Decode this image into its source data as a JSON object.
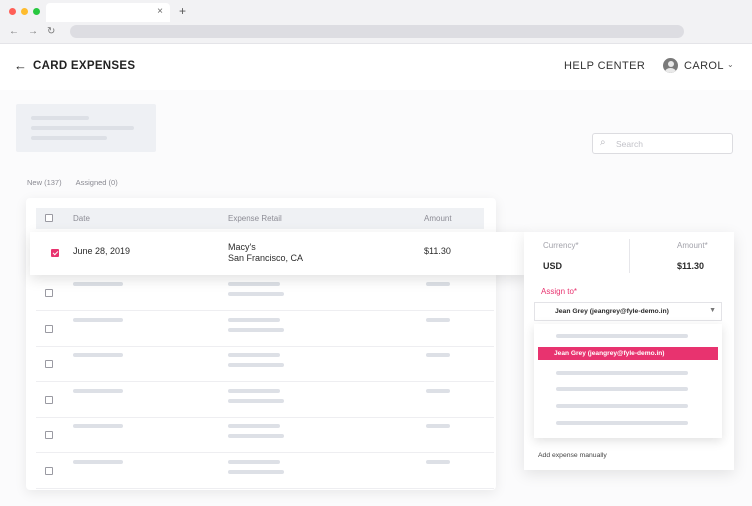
{
  "browser": {
    "dot_colors": [
      "#ff5f57",
      "#febc2e",
      "#28c840"
    ],
    "tab_close": "×",
    "new_tab": "+",
    "nav_back": "←",
    "nav_forward": "→",
    "nav_reload": "↻"
  },
  "header": {
    "back_icon": "←",
    "title": "CARD EXPENSES",
    "help_label": "HELP CENTER",
    "user_name": "CAROL",
    "user_caret": "⌄"
  },
  "search": {
    "icon": "⌕",
    "placeholder": "Search"
  },
  "tabs": [
    {
      "label": "New (137)"
    },
    {
      "label": "Assigned (0)"
    }
  ],
  "table": {
    "columns": [
      "Date",
      "Expense Retail",
      "Amount"
    ],
    "selected_row": {
      "date": "June 28, 2019",
      "merchant": "Macy's",
      "location": "San Francisco, CA",
      "amount": "$11.30",
      "checked": true
    },
    "placeholder_rows": 6
  },
  "panel": {
    "currency_label": "Currency*",
    "currency_value": "USD",
    "amount_label": "Amount*",
    "amount_value": "$11.30",
    "assign_label": "Assign to*",
    "assign_value": "Jean Grey (jeangrey@fyle-demo.in)",
    "dropdown_arrow": "▼",
    "highlighted_option": "Jean Grey (jeangrey@fyle-demo.in)",
    "add_manual": "Add expense manually"
  },
  "colors": {
    "accent": "#e8336f"
  }
}
